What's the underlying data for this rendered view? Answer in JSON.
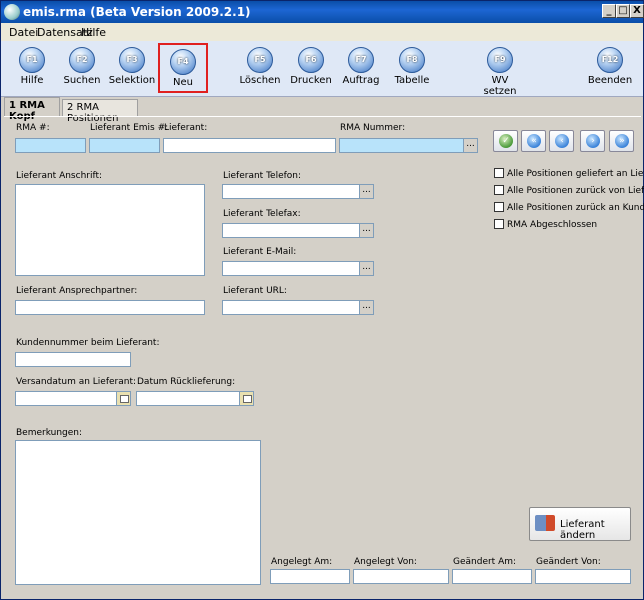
{
  "window": {
    "title": "emis.rma (Beta Version 2009.2.1)",
    "minimize": "_",
    "restore": "□",
    "close": "X"
  },
  "menu": [
    "Datei",
    "Datensatz",
    "Hilfe"
  ],
  "toolbar": [
    {
      "key": "F1",
      "label": "Hilfe"
    },
    {
      "key": "F2",
      "label": "Suchen"
    },
    {
      "key": "F3",
      "label": "Selektion"
    },
    {
      "key": "F4",
      "label": "Neu"
    },
    {
      "key": "F5",
      "label": "Löschen"
    },
    {
      "key": "F6",
      "label": "Drucken"
    },
    {
      "key": "F7",
      "label": "Auftrag"
    },
    {
      "key": "F8",
      "label": "Tabelle"
    },
    {
      "key": "F9",
      "label": "WV setzen"
    },
    {
      "key": "F12",
      "label": "Beenden"
    }
  ],
  "tabs": [
    "1 RMA Kopf",
    "2 RMA Positionen"
  ],
  "form": {
    "rma_nr": "RMA #:",
    "lieferant_emis_nr": "Lieferant Emis #:",
    "lieferant": "Lieferant:",
    "rma_nummer": "RMA Nummer:",
    "lieferant_anschrift": "Lieferant Anschrift:",
    "lieferant_telefon": "Lieferant Telefon:",
    "lieferant_telefax": "Lieferant Telefax:",
    "lieferant_email": "Lieferant E-Mail:",
    "lieferant_ansprechpartner": "Lieferant Ansprechpartner:",
    "lieferant_url": "Lieferant URL:",
    "kundennummer": "Kundennummer beim Lieferant:",
    "versanddatum": "Versandatum an Lieferant:",
    "datum_rueck": "Datum Rücklieferung:",
    "bemerkungen": "Bemerkungen:",
    "angelegt_am": "Angelegt Am:",
    "angelegt_von": "Angelegt Von:",
    "geaendert_am": "Geändert Am:",
    "geaendert_von": "Geändert Von:",
    "ellipsis": "..."
  },
  "checkboxes": [
    "Alle Positionen geliefert an Lieferant",
    "Alle Positionen zurück von Lieferant",
    "Alle Positionen zurück an Kunden",
    "RMA Abgeschlossen"
  ],
  "actions": {
    "lieferant_aendern": "Lieferant ändern"
  },
  "nav_icons": [
    "check-icon",
    "first-icon",
    "previous-icon",
    "next-icon",
    "last-icon"
  ]
}
